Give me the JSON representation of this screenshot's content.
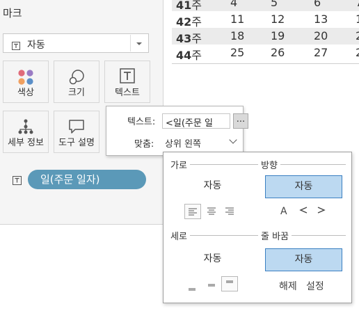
{
  "marks": {
    "title": "마크",
    "mark_type": "자동",
    "tiles": [
      {
        "label": "색상",
        "icon": "color-icon"
      },
      {
        "label": "크기",
        "icon": "size-icon"
      },
      {
        "label": "텍스트",
        "icon": "text-icon"
      },
      {
        "label": "세부 정보",
        "icon": "detail-icon"
      },
      {
        "label": "도구 설명",
        "icon": "tooltip-icon"
      }
    ],
    "pill_label": "일(주문 일자)",
    "pill_color": "#5b99b8"
  },
  "table": {
    "rows": [
      {
        "week_num": "41",
        "week_suffix": "주",
        "cells": [
          "4",
          "5",
          "6",
          "7"
        ]
      },
      {
        "week_num": "42",
        "week_suffix": "주",
        "cells": [
          "11",
          "12",
          "13",
          "1"
        ]
      },
      {
        "week_num": "43",
        "week_suffix": "주",
        "cells": [
          "18",
          "19",
          "20",
          "2"
        ]
      },
      {
        "week_num": "44",
        "week_suffix": "주",
        "cells": [
          "25",
          "26",
          "27",
          "2"
        ]
      }
    ]
  },
  "text_popup": {
    "text_label": "텍스트:",
    "text_value": "<일(주문 일",
    "ellipsis": "...",
    "align_label": "맞춤:",
    "align_value": "상위 왼쪽"
  },
  "align_popup": {
    "horizontal_label": "가로",
    "direction_label": "방향",
    "horizontal_auto": "자동",
    "direction_auto": "자동",
    "vertical_label": "세로",
    "wrap_label": "줄 바꿈",
    "vertical_auto": "자동",
    "wrap_auto": "자동",
    "wrap_off": "해제",
    "wrap_on": "설정",
    "direction_glyphs": [
      "A",
      "∢",
      "∢"
    ],
    "selected_color": "#bcd9f1",
    "selected_border": "#3a7fc1"
  }
}
